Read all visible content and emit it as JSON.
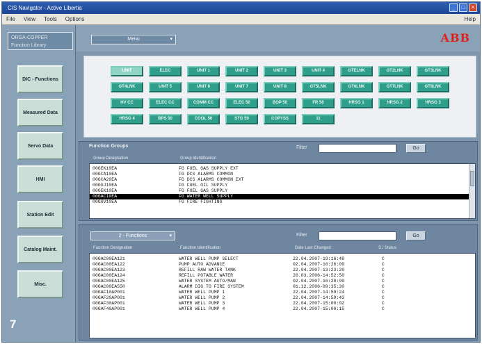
{
  "window": {
    "title": "CIS Navigator - Active Libertia",
    "controls": [
      "_",
      "□",
      "×"
    ]
  },
  "menu": {
    "items": [
      "File",
      "View",
      "Tools",
      "Options"
    ],
    "help": "Help"
  },
  "left_panel": {
    "combo_line1": "ORGA-COPPER",
    "combo_line2": "Function Library",
    "nav_buttons": [
      "DIC - Functions",
      "Measured Data",
      "Servo Data",
      "HMI",
      "Station Edit",
      "Catalog Maint.",
      "Misc."
    ]
  },
  "top_bar": {
    "menu_label": "Menu",
    "logo": "ABB"
  },
  "units": [
    "UNIT",
    "ELEC",
    "UNIT 1",
    "UNIT 2",
    "UNIT 3",
    "UNIT 4",
    "GTELNK",
    "GT2LNK",
    "GT3LNK",
    "GT4LNK",
    "UNIT 5",
    "UNIT 6",
    "UNIT 7",
    "UNIT 8",
    "GT5LNK",
    "GT6LNK",
    "GT7LNK",
    "GT8LNK",
    "HV CC",
    "ELEC CC",
    "COMM CC",
    "ELEC 50",
    "BOP 50",
    "FR 50",
    "HRSG 1",
    "HRSG 2",
    "HRSG 3",
    "HRSG 4",
    "BPS 50",
    "COOL 50",
    "STG 50",
    "COPYSS",
    "11"
  ],
  "selected_unit": "UNIT",
  "function_groups": {
    "title": "Function Groups",
    "filter_label": "Filter",
    "filter_value": "",
    "go_label": "Go",
    "columns": [
      "Group Designation",
      "Group Identification"
    ],
    "rows": [
      {
        "code": "00GEK10EA",
        "desc": "FG FUEL GAS SUPPLY EXT"
      },
      {
        "code": "00GCA10EA",
        "desc": "FG DCS ALARMS COMMON"
      },
      {
        "code": "00GCA20EA",
        "desc": "FG DCS ALARMS COMMON EXT"
      },
      {
        "code": "00GGJ10EA",
        "desc": "FG FUEL OIL SUPPLY"
      },
      {
        "code": "00GEK10EA",
        "desc": "FG FUEL GAS SUPPLY"
      },
      {
        "code": "00GAC10EA",
        "desc": "FG WATER WELL SUPPLY"
      },
      {
        "code": "00GGV10EA",
        "desc": "FG FIRE FIGHTING"
      }
    ],
    "selected_index": 5
  },
  "functions": {
    "dropdown_label": "2 - Functions",
    "filter_label": "Filter",
    "filter_value": "",
    "go_label": "Go",
    "columns": [
      "Function Designation",
      "Function Identification",
      "Date Last Changed",
      "S / Status"
    ],
    "rows": [
      {
        "code": "00GAC00EA121",
        "desc": "WATER WELL PUMP SELECT",
        "date": "22.04.2007-19:16:48",
        "s": "C"
      },
      {
        "code": "00GAC00EA122",
        "desc": "PUMP AUTO ADVANCE",
        "date": "02.04.2007-16:26:09",
        "s": "C"
      },
      {
        "code": "00GAC00EA123",
        "desc": "REFILL RAW WATER TANK",
        "date": "22.04.2007-13:23:20",
        "s": "C"
      },
      {
        "code": "00GAC00EA124",
        "desc": "REFILL POTABLE WATER",
        "date": "26.03.2006-14:52:50",
        "s": "C"
      },
      {
        "code": "00GAC00EA125",
        "desc": "WATER SYSTEM AUTO/MAN",
        "date": "02.04.2007-16:28:09",
        "s": "C"
      },
      {
        "code": "00GAC00EA550",
        "desc": "ALARM DIG TO FIRE SYSTEM",
        "date": "01.12.2006-09:35:30",
        "s": "C"
      },
      {
        "code": "00GAF10AP001",
        "desc": "WATER WELL PUMP 1",
        "date": "22.04.2007-14:59:24",
        "s": "C"
      },
      {
        "code": "00GAF20AP001",
        "desc": "WATER WELL PUMP 2",
        "date": "22.04.2007-14:59:43",
        "s": "C"
      },
      {
        "code": "00GAF30AP001",
        "desc": "WATER WELL PUMP 3",
        "date": "22.04.2007-15:00:02",
        "s": "C"
      },
      {
        "code": "00GAF40AP001",
        "desc": "WATER WELL PUMP 4",
        "date": "22.04.2007-15:00:15",
        "s": "C"
      }
    ]
  },
  "figure_number": "7"
}
